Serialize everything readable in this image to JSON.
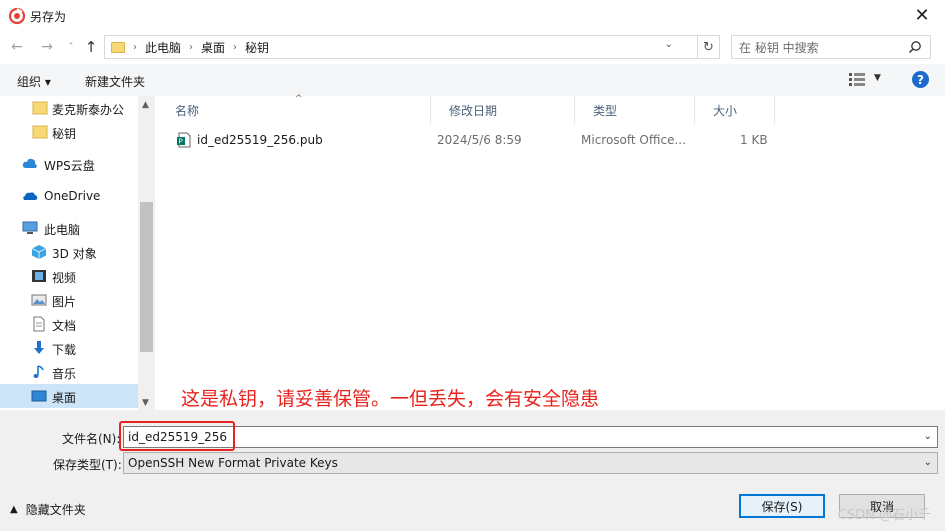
{
  "window": {
    "title": "另存为",
    "close_label": "✕"
  },
  "nav": {
    "back": "←",
    "forward": "→",
    "recent": "˅",
    "up": "↑",
    "breadcrumb": [
      "此电脑",
      "桌面",
      "秘钥"
    ],
    "search_placeholder": "在 秘钥 中搜索"
  },
  "toolbar": {
    "organize": "组织 ▾",
    "new_folder": "新建文件夹",
    "help": "?"
  },
  "sidebar": {
    "items": [
      {
        "label": "麦克斯泰办公",
        "icon": "folder-icon"
      },
      {
        "label": "秘钥",
        "icon": "folder-icon"
      },
      {
        "label": "WPS云盘",
        "icon": "cloud-icon"
      },
      {
        "label": "OneDrive",
        "icon": "onedrive-icon"
      },
      {
        "label": "此电脑",
        "icon": "computer-icon"
      },
      {
        "label": "3D 对象",
        "icon": "cube-icon"
      },
      {
        "label": "视频",
        "icon": "video-icon"
      },
      {
        "label": "图片",
        "icon": "picture-icon"
      },
      {
        "label": "文档",
        "icon": "document-icon"
      },
      {
        "label": "下载",
        "icon": "download-icon"
      },
      {
        "label": "音乐",
        "icon": "music-icon"
      },
      {
        "label": "桌面",
        "icon": "desktop-icon"
      }
    ]
  },
  "columns": [
    "名称",
    "修改日期",
    "类型",
    "大小"
  ],
  "files": [
    {
      "name": "id_ed25519_256.pub",
      "modified": "2024/5/6 8:59",
      "type": "Microsoft Office...",
      "size": "1 KB"
    }
  ],
  "annotation": "这是私钥，请妥善保管。一但丢失，会有安全隐患",
  "form": {
    "filename_label": "文件名(N):",
    "filename_value": "id_ed25519_256",
    "filetype_label": "保存类型(T):",
    "filetype_value": "OpenSSH New Format Private Keys"
  },
  "footer": {
    "hide_folders": "隐藏文件夹",
    "save": "保存(S)",
    "cancel": "取消"
  },
  "watermark": "CSDN @石小千",
  "colors": {
    "accent": "#0078d7",
    "annotation": "#e8231d",
    "selection": "#cce4f7"
  }
}
